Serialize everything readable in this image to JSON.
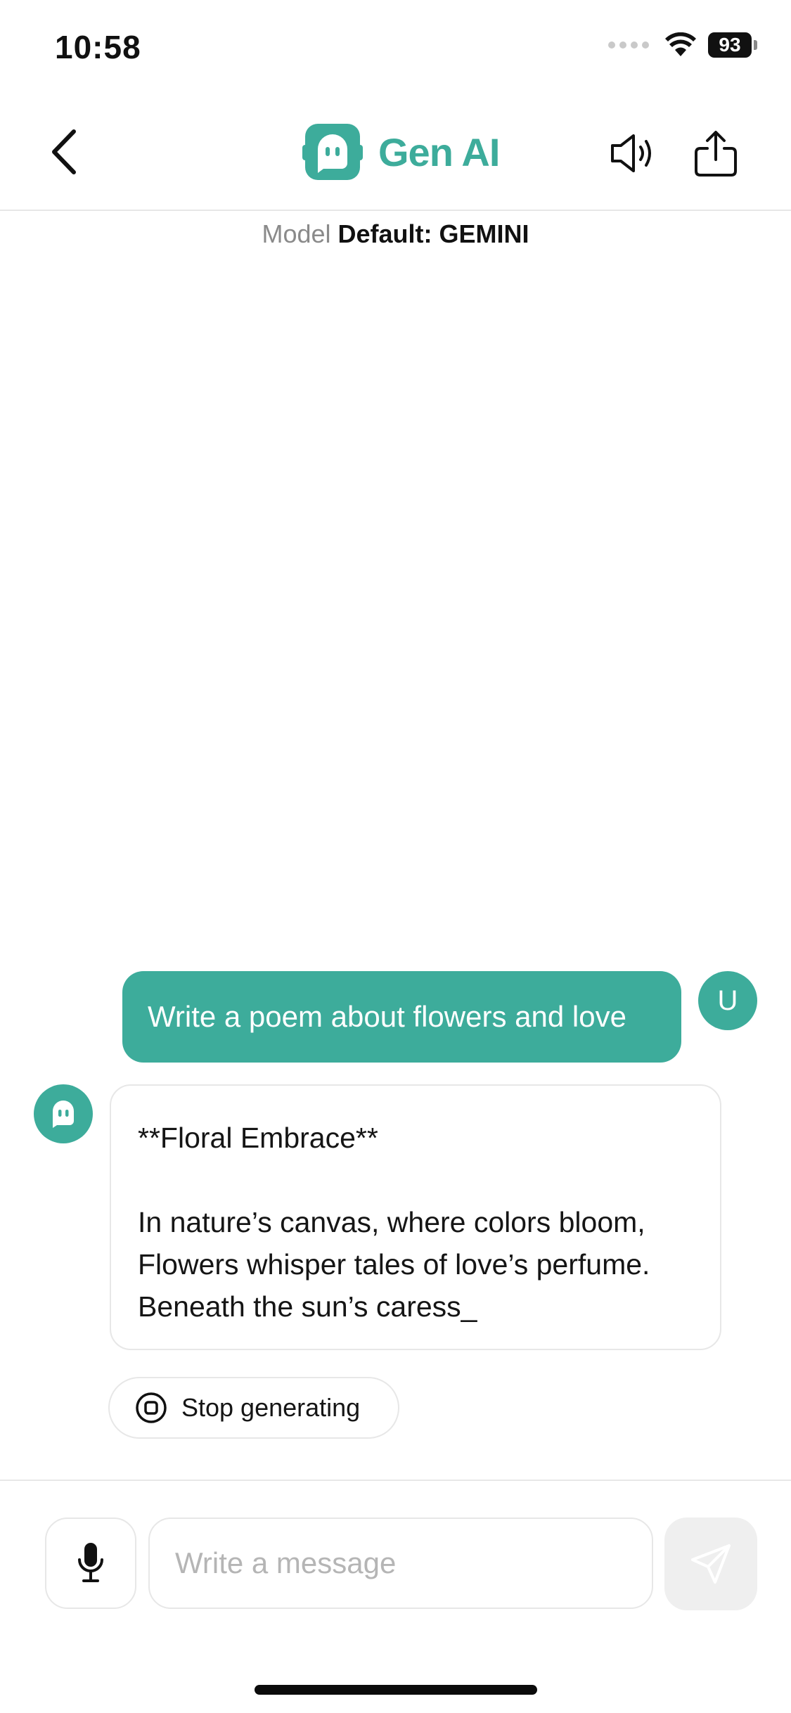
{
  "status_bar": {
    "time": "10:58",
    "battery": "93"
  },
  "header": {
    "brand_name": "Gen AI"
  },
  "model": {
    "label": "Model",
    "value": "Default: GEMINI"
  },
  "chat": {
    "user_avatar": "U",
    "user_message": "Write a poem about flowers and love",
    "bot_lines": [
      "**Floral Embrace**",
      "In nature’s canvas, where colors bloom,",
      "Flowers whisper tales of love’s perfume.",
      "Beneath the sun’s caress_"
    ]
  },
  "actions": {
    "stop_label": "Stop generating"
  },
  "composer": {
    "placeholder": "Write a message"
  },
  "colors": {
    "accent": "#3dac9b",
    "border": "#e7e7e7",
    "send_disabled_bg": "#efefef"
  },
  "icons": {
    "back": "chevron-left-icon",
    "logo": "chat-bot-logo-icon",
    "speaker": "speaker-icon",
    "share": "share-icon",
    "stop": "stop-circle-icon",
    "mic": "microphone-icon",
    "send": "send-icon"
  }
}
